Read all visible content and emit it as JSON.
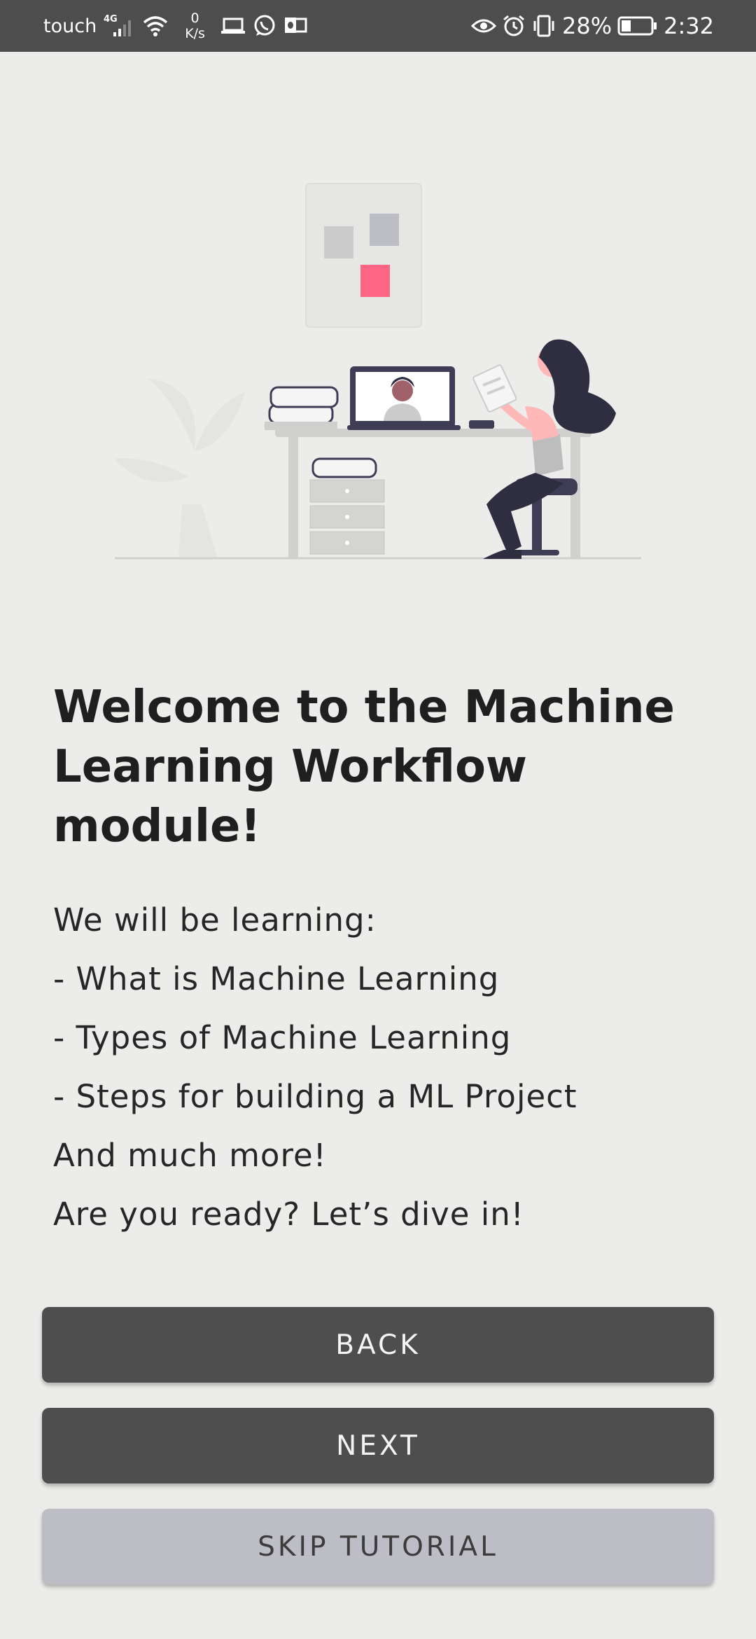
{
  "status_bar": {
    "carrier": "touch",
    "network": "4G",
    "speed_value": "0",
    "speed_unit": "K/s",
    "battery": "28%",
    "time": "2:32"
  },
  "content": {
    "title": "Welcome to the Machine Learning Workflow module!",
    "lines": [
      "We will be learning:",
      "- What is Machine Learning",
      "- Types of Machine Learning",
      "- Steps for building a ML Project",
      "And much more!",
      "Are you ready? Let’s dive in!"
    ]
  },
  "buttons": {
    "back": "BACK",
    "next": "NEXT",
    "skip": "SKIP TUTORIAL"
  },
  "colors": {
    "status_bar": "#4d4d4d",
    "background": "#ececea",
    "button_dark": "#4e4e4e",
    "button_skip": "#bdbdc5",
    "accent_pink": "#ff6584",
    "figure_dark": "#3f3d56"
  }
}
